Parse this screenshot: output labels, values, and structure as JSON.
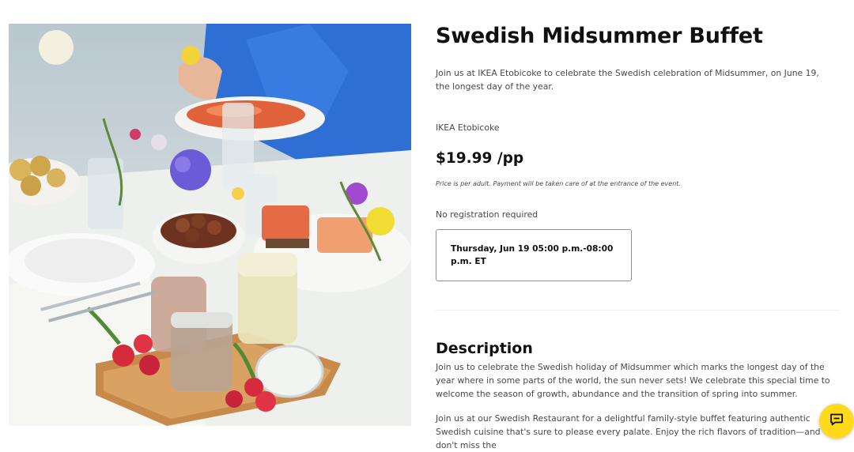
{
  "event": {
    "image_alt": "Swedish midsummer buffet table",
    "title": "Swedish Midsummer Buffet",
    "intro": "Join us at IKEA Etobicoke to celebrate the Swedish celebration of Midsummer, on June 19, the longest day of the year.",
    "location": "IKEA Etobicoke",
    "price": "$19.99 /pp",
    "price_note": "Price is per adult. Payment will be taken care of at the entrance of the event.",
    "registration": "No registration required",
    "date_time": "Thursday, Jun 19 05:00 p.m.-08:00 p.m. ET"
  },
  "description": {
    "heading": "Description",
    "paragraph1": "Join us to celebrate the Swedish holiday of Midsummer which marks the longest day of the year where in some parts of the world, the sun never sets! We celebrate this special time to welcome the season of growth, abundance and the transition of spring into summer.",
    "paragraph2": "Join us at our Swedish Restaurant for a delightful family-style buffet featuring authentic Swedish cuisine that's sure to please every palate. Enjoy the rich flavors of tradition—and don't miss the"
  },
  "chat": {
    "icon": "chat-bubble-icon",
    "color": "#ffda1a"
  }
}
